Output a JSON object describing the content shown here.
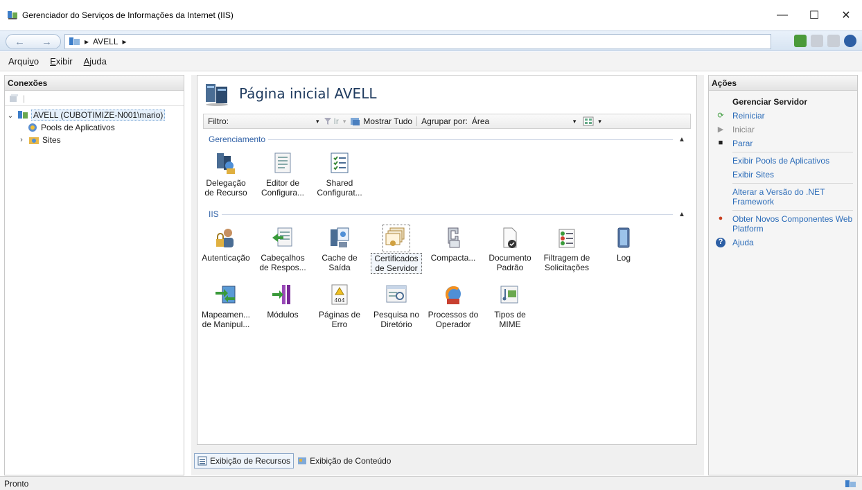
{
  "window": {
    "title": "Gerenciador do Serviços de Informações da Internet (IIS)",
    "controls": {
      "minimize": "—",
      "maximize": "☐",
      "close": "✕"
    }
  },
  "address": {
    "back": "←",
    "forward": "→",
    "path_separator": "▸",
    "path": "AVELL",
    "trailing": "▸"
  },
  "menu": {
    "items": [
      {
        "pre": "Arqui",
        "u": "v",
        "post": "o"
      },
      {
        "pre": "",
        "u": "E",
        "post": "xibir"
      },
      {
        "pre": "",
        "u": "A",
        "post": "juda"
      }
    ]
  },
  "connections": {
    "header": "Conexões",
    "tree": {
      "root": "AVELL (CUBOTIMIZE-N001\\mario)",
      "root_toggle": "⌄",
      "app_pools": "Pools de Aplicativos",
      "sites": "Sites",
      "sites_toggle": "›"
    }
  },
  "main": {
    "title": "Página inicial AVELL",
    "filter": {
      "label": "Filtro:",
      "go": "Ir",
      "show_all": "Mostrar Tudo",
      "group_by_label": "Agrupar por:",
      "group_by_value": "Área",
      "dropdown_glyph": "▾"
    },
    "sections": [
      {
        "title": "Gerenciamento",
        "features": [
          {
            "label": "Delegação de Recurso",
            "icon": "delegation-icon"
          },
          {
            "label": "Editor de Configura...",
            "icon": "config-editor-icon"
          },
          {
            "label": "Shared Configurat...",
            "icon": "shared-config-icon"
          }
        ]
      },
      {
        "title": "IIS",
        "features": [
          {
            "label": "Autenticação",
            "icon": "authentication-icon"
          },
          {
            "label": "Cabeçalhos de Respos...",
            "icon": "response-headers-icon"
          },
          {
            "label": "Cache de Saída",
            "icon": "output-cache-icon"
          },
          {
            "label": "Certificados de Servidor",
            "icon": "server-certificates-icon"
          },
          {
            "label": "Compacta...",
            "icon": "compression-icon"
          },
          {
            "label": "Documento Padrão",
            "icon": "default-document-icon"
          },
          {
            "label": "Filtragem de Solicitações",
            "icon": "request-filtering-icon"
          },
          {
            "label": "Log",
            "icon": "logging-icon"
          },
          {
            "label": "Mapeamen... de Manipul...",
            "icon": "handler-mappings-icon"
          },
          {
            "label": "Módulos",
            "icon": "modules-icon"
          },
          {
            "label": "Páginas de Erro",
            "icon": "error-pages-icon"
          },
          {
            "label": "Pesquisa no Diretório",
            "icon": "directory-browsing-icon"
          },
          {
            "label": "Processos do Operador",
            "icon": "worker-processes-icon"
          },
          {
            "label": "Tipos de MIME",
            "icon": "mime-types-icon"
          }
        ]
      }
    ],
    "error_page_badge": "404",
    "view_tabs": {
      "features": "Exibição de Recursos",
      "content": "Exibição de Conteúdo"
    }
  },
  "actions": {
    "header": "Ações",
    "group_title": "Gerenciar Servidor",
    "items": {
      "restart": "Reiniciar",
      "start": "Iniciar",
      "stop": "Parar",
      "view_app_pools": "Exibir Pools de Aplicativos",
      "view_sites": "Exibir Sites",
      "change_net": "Alterar a Versão do .NET Framework",
      "get_components": "Obter Novos Componentes Web Platform",
      "help": "Ajuda"
    }
  },
  "status": {
    "text": "Pronto"
  },
  "colors": {
    "accent_link": "#2a6bb8",
    "section_blue": "#3464a8",
    "selection": "#e5f0fb"
  }
}
